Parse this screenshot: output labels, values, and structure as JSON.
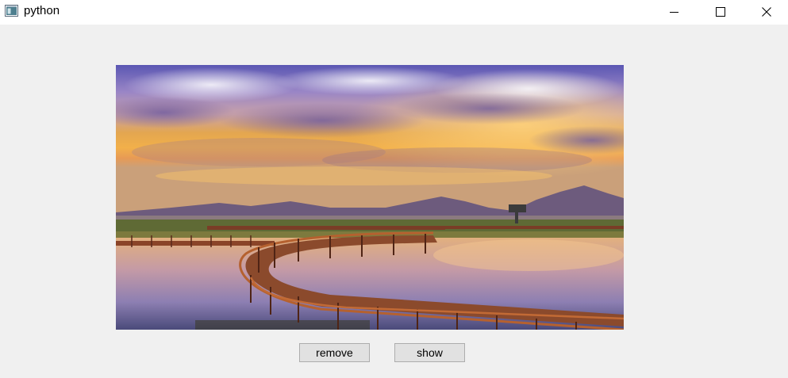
{
  "window": {
    "title": "python",
    "app_icon": "python-app-icon",
    "controls": {
      "minimize_icon": "minimize-icon",
      "maximize_icon": "maximize-icon",
      "close_icon": "close-icon"
    }
  },
  "main": {
    "image": {
      "description_icon": "landscape-photo",
      "subject": "boardwalk over lake at sunset"
    },
    "buttons": {
      "remove_label": "remove",
      "show_label": "show"
    }
  },
  "colors": {
    "titlebar": "#ffffff",
    "client_bg": "#f0f0f0",
    "button_bg": "#e1e1e1",
    "button_border": "#adadad"
  }
}
